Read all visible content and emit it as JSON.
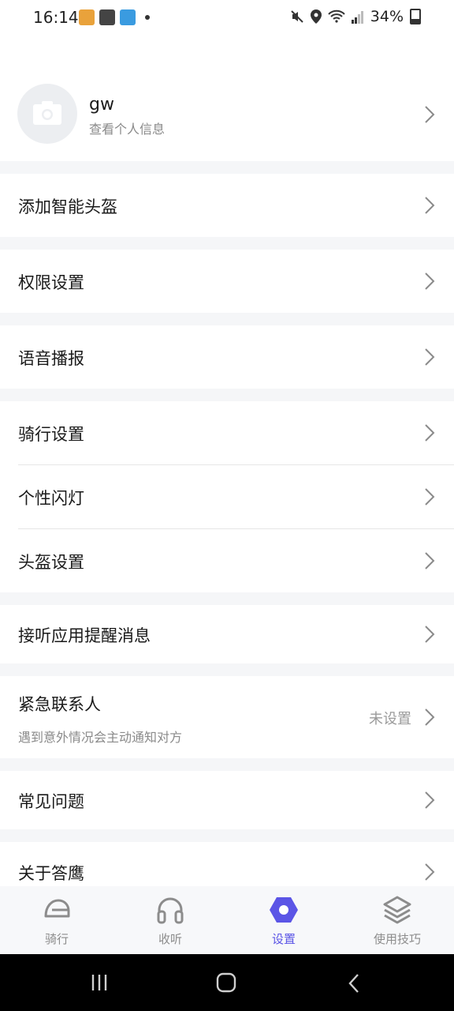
{
  "status": {
    "time": "16:14",
    "battery": "34%"
  },
  "profile": {
    "name": "gw",
    "subtitle": "查看个人信息"
  },
  "menu": {
    "add_helmet": "添加智能头盔",
    "permissions": "权限设置",
    "voice": "语音播报",
    "riding_settings": "骑行设置",
    "light": "个性闪灯",
    "helmet_settings": "头盔设置",
    "notifications": "接听应用提醒消息",
    "emergency": {
      "label": "紧急联系人",
      "sub": "遇到意外情况会主动通知对方",
      "value": "未设置"
    },
    "faq": "常见问题",
    "about": "关于答鹰"
  },
  "tabs": [
    {
      "label": "骑行",
      "icon": "helmet-icon",
      "active": false
    },
    {
      "label": "收听",
      "icon": "headphones-icon",
      "active": false
    },
    {
      "label": "设置",
      "icon": "settings-hex-icon",
      "active": true
    },
    {
      "label": "使用技巧",
      "icon": "layers-icon",
      "active": false
    }
  ],
  "colors": {
    "accent": "#5b55e6",
    "background": "#f5f6f8",
    "card": "#ffffff"
  }
}
